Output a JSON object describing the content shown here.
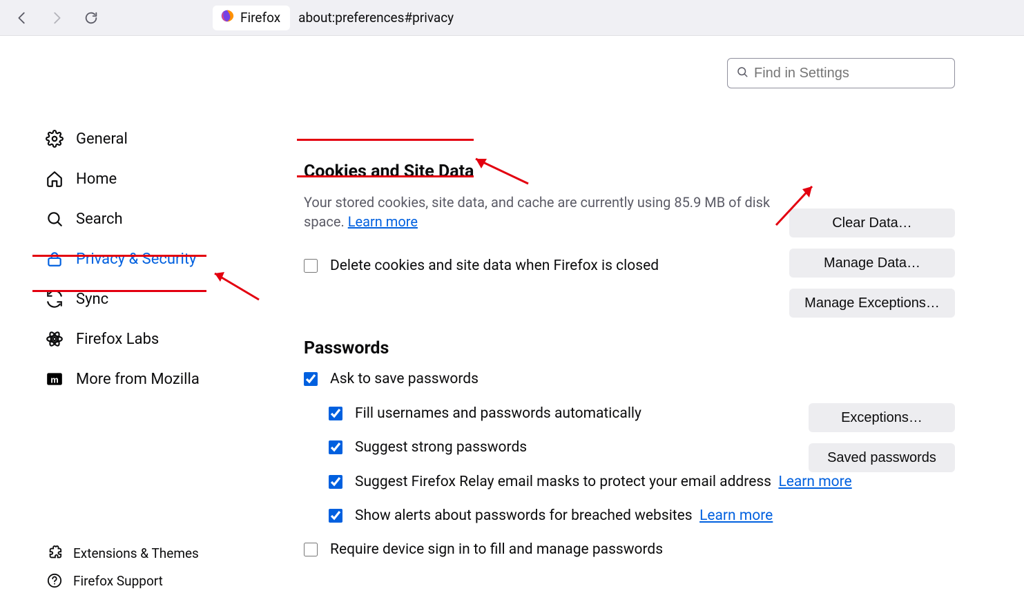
{
  "toolbar": {
    "identity_label": "Firefox",
    "url": "about:preferences#privacy"
  },
  "search": {
    "placeholder": "Find in Settings"
  },
  "sidebar": {
    "items": [
      {
        "label": "General"
      },
      {
        "label": "Home"
      },
      {
        "label": "Search"
      },
      {
        "label": "Privacy & Security"
      },
      {
        "label": "Sync"
      },
      {
        "label": "Firefox Labs"
      },
      {
        "label": "More from Mozilla"
      }
    ],
    "footer": [
      {
        "label": "Extensions & Themes"
      },
      {
        "label": "Firefox Support"
      }
    ]
  },
  "cookies": {
    "heading": "Cookies and Site Data",
    "desc_prefix": "Your stored cookies, site data, and cache are currently using ",
    "usage": "85.9 MB",
    "desc_suffix": " of disk space. ",
    "learn_more": "Learn more",
    "delete_on_close": "Delete cookies and site data when Firefox is closed",
    "buttons": {
      "clear": "Clear Data…",
      "manage": "Manage Data…",
      "exceptions": "Manage Exceptions…"
    }
  },
  "passwords": {
    "heading": "Passwords",
    "ask_save": "Ask to save passwords",
    "fill_auto": "Fill usernames and passwords automatically",
    "suggest_strong": "Suggest strong passwords",
    "relay": "Suggest Firefox Relay email masks to protect your email address",
    "relay_learn": "Learn more",
    "breach": "Show alerts about passwords for breached websites",
    "breach_learn": "Learn more",
    "device_signin": "Require device sign in to fill and manage passwords",
    "buttons": {
      "exceptions": "Exceptions…",
      "saved": "Saved passwords"
    }
  }
}
